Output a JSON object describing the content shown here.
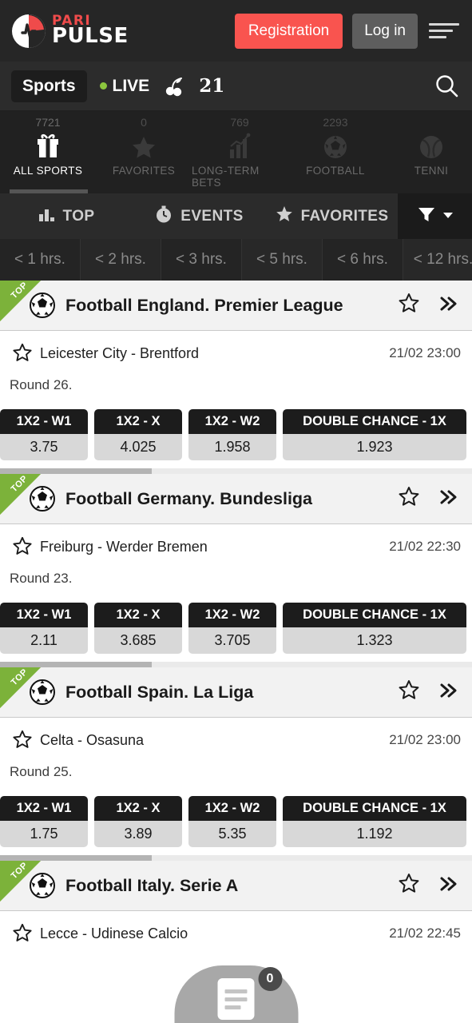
{
  "brand": {
    "name_top": "PARI",
    "name_bottom": "PULSE",
    "logo_icon": "pulse-logo-icon",
    "accent_red": "#f9544f",
    "accent_green": "#7cb23a"
  },
  "header": {
    "registration_label": "Registration",
    "login_label": "Log in",
    "menu_icon": "hamburger-menu-icon"
  },
  "navbar": {
    "sports_label": "Sports",
    "live_label": "LIVE",
    "live_dot_color": "#8cc63e",
    "casino_icon": "cherry-icon",
    "blackjack_label": "21",
    "search_icon": "search-icon"
  },
  "sports_strip": {
    "items": [
      {
        "label": "ALL SPORTS",
        "count": "7721",
        "icon": "gift-icon",
        "active": true
      },
      {
        "label": "FAVORITES",
        "count": "0",
        "icon": "star-icon",
        "active": false
      },
      {
        "label": "LONG-TERM BETS",
        "count": "769",
        "icon": "bar-chart-icon",
        "active": false
      },
      {
        "label": "FOOTBALL",
        "count": "2293",
        "icon": "football-icon",
        "active": false
      },
      {
        "label": "TENNI",
        "count": "",
        "icon": "tennis-ball-icon",
        "active": false
      }
    ]
  },
  "tabs": {
    "items": [
      {
        "label": "TOP",
        "icon": "bar-chart-icon"
      },
      {
        "label": "EVENTS",
        "icon": "stopwatch-icon"
      },
      {
        "label": "FAVORITES",
        "icon": "star-icon"
      }
    ],
    "filter_icon": "funnel-filter-icon",
    "filter_caret_icon": "chevron-down-icon"
  },
  "time_filters": {
    "items": [
      "< 1 hrs.",
      "< 2 hrs.",
      "< 3 hrs.",
      "< 5 hrs.",
      "< 6 hrs.",
      "< 12 hrs."
    ]
  },
  "leagues": [
    {
      "ribbon": "TOP",
      "icon": "football-icon",
      "title": "Football England. Premier League",
      "star_icon": "star-outline-icon",
      "expand_icon": "double-chevron-right-icon",
      "match": {
        "star_icon": "star-outline-icon",
        "teams": "Leicester City - Brentford",
        "datetime": "21/02 23:00",
        "round": "Round 26."
      },
      "odds": [
        {
          "label": "1X2 - W1",
          "value": "3.75",
          "width": "small"
        },
        {
          "label": "1X2 - X",
          "value": "4.025",
          "width": "small"
        },
        {
          "label": "1X2 - W2",
          "value": "1.958",
          "width": "small"
        },
        {
          "label": "DOUBLE CHANCE - 1X",
          "value": "1.923",
          "width": "large"
        }
      ],
      "scroll_pct": 33
    },
    {
      "ribbon": "TOP",
      "icon": "football-icon",
      "title": "Football Germany. Bundesliga",
      "star_icon": "star-outline-icon",
      "expand_icon": "double-chevron-right-icon",
      "match": {
        "star_icon": "star-outline-icon",
        "teams": "Freiburg - Werder Bremen",
        "datetime": "21/02 22:30",
        "round": "Round 23."
      },
      "odds": [
        {
          "label": "1X2 - W1",
          "value": "2.11",
          "width": "small"
        },
        {
          "label": "1X2 - X",
          "value": "3.685",
          "width": "small"
        },
        {
          "label": "1X2 - W2",
          "value": "3.705",
          "width": "small"
        },
        {
          "label": "DOUBLE CHANCE - 1X",
          "value": "1.323",
          "width": "large"
        }
      ],
      "scroll_pct": 33
    },
    {
      "ribbon": "TOP",
      "icon": "football-icon",
      "title": "Football Spain. La Liga",
      "star_icon": "star-outline-icon",
      "expand_icon": "double-chevron-right-icon",
      "match": {
        "star_icon": "star-outline-icon",
        "teams": "Celta - Osasuna",
        "datetime": "21/02 23:00",
        "round": "Round 25."
      },
      "odds": [
        {
          "label": "1X2 - W1",
          "value": "1.75",
          "width": "small"
        },
        {
          "label": "1X2 - X",
          "value": "3.89",
          "width": "small"
        },
        {
          "label": "1X2 - W2",
          "value": "5.35",
          "width": "small"
        },
        {
          "label": "DOUBLE CHANCE - 1X",
          "value": "1.192",
          "width": "large"
        }
      ],
      "scroll_pct": 33
    },
    {
      "ribbon": "TOP",
      "icon": "football-icon",
      "title": "Football Italy. Serie A",
      "star_icon": "star-outline-icon",
      "expand_icon": "double-chevron-right-icon",
      "match": {
        "star_icon": "star-outline-icon",
        "teams": "Lecce - Udinese Calcio",
        "datetime": "21/02 22:45",
        "round": ""
      },
      "odds": [],
      "scroll_pct": 0
    }
  ],
  "betslip": {
    "count": "0",
    "icon": "betslip-document-icon"
  }
}
